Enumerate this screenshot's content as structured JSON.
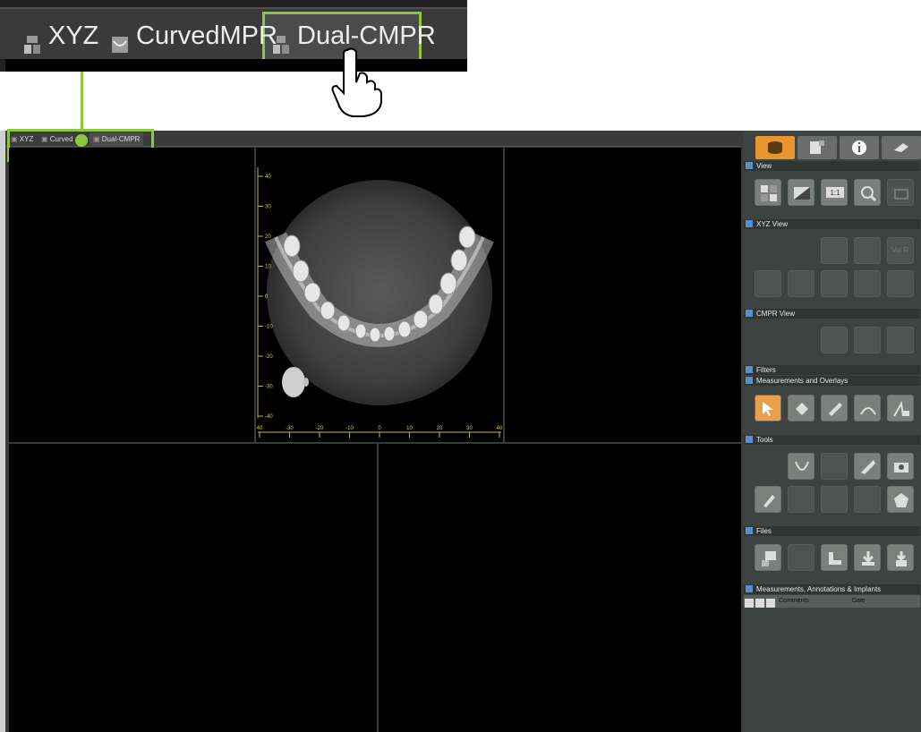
{
  "zoom_tabs": {
    "items": [
      {
        "label": "XYZ"
      },
      {
        "label": "CurvedMPR"
      },
      {
        "label": "Dual-CMPR"
      }
    ]
  },
  "window_tabs": {
    "items": [
      {
        "label": "XYZ"
      },
      {
        "label": "Curved"
      },
      {
        "label": "Dual-CMPR"
      }
    ]
  },
  "axial_view": {
    "y_ticks": [
      "40",
      "30",
      "20",
      "10",
      "0",
      "-10",
      "-20",
      "-30",
      "-40"
    ],
    "x_ticks": [
      "40",
      "-30",
      "-20",
      "-10",
      "0",
      "10",
      "20",
      "30",
      "40"
    ]
  },
  "panel": {
    "sections": {
      "view": "View",
      "xyz_view": "XYZ View",
      "cmpr_view": "CMPR View",
      "filters": "Filters",
      "measurements_overlays": "Measurements and Overlays",
      "tools": "Tools",
      "files": "Files",
      "mai": "Measurements, Annotations & Implants"
    },
    "zoom_1to1_label": "1:1",
    "vol_label": "Vol R",
    "mai_columns": {
      "comments": "Comments",
      "date": "Date"
    }
  },
  "colors": {
    "highlight": "#8cc63f",
    "active_tab": "#e8952d",
    "panel_bg": "#3d4340",
    "section_bar": "#2f3532"
  }
}
